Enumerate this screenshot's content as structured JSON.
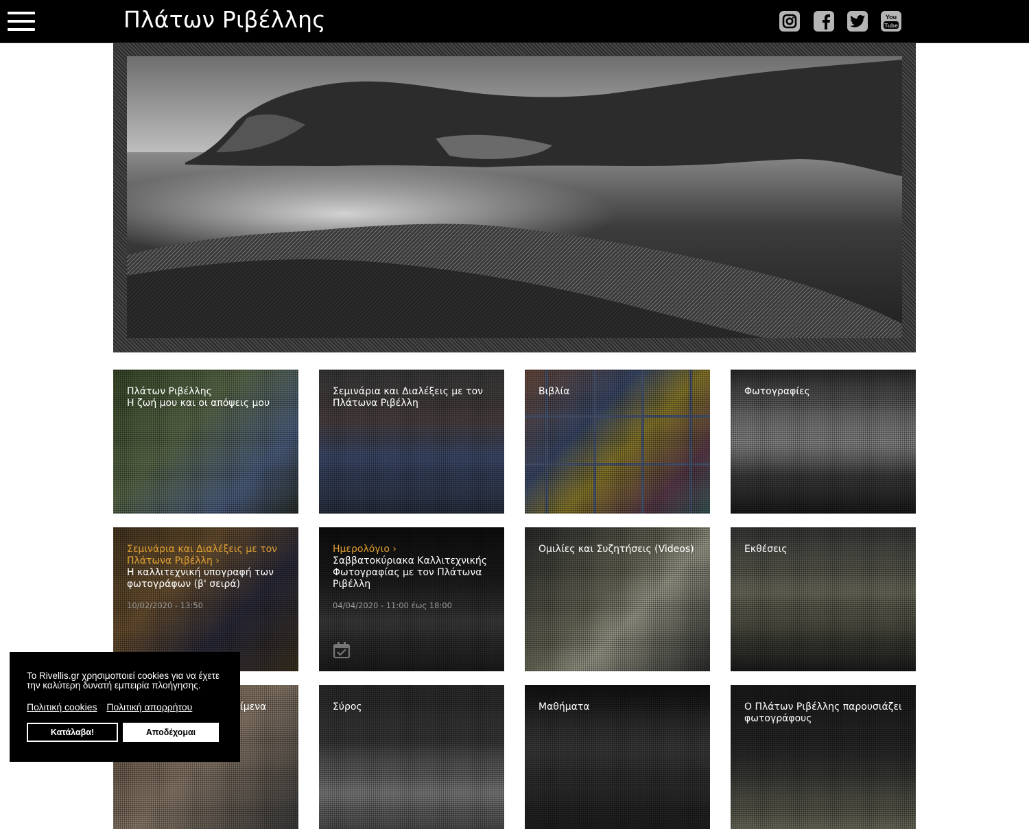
{
  "header": {
    "menu_icon": "hamburger-icon",
    "site_title": "Πλάτων Ριβέλλης",
    "social": [
      {
        "name": "instagram-icon"
      },
      {
        "name": "facebook-icon"
      },
      {
        "name": "twitter-icon"
      },
      {
        "name": "youtube-icon",
        "label": "You Tube"
      }
    ]
  },
  "hero": {
    "image": "black-and-white-coastal-bay-photo"
  },
  "tiles": [
    {
      "title": "Πλάτων Ριβέλλης",
      "subtitle": "Η ζωή μου και οι απόψεις μου"
    },
    {
      "title": "Σεμινάρια και Διαλέξεις με τον Πλάτωνα Ριβέλλη"
    },
    {
      "title": "Βιβλία"
    },
    {
      "title": "Φωτογραφίες"
    },
    {
      "category": "Σεμινάρια και Διαλέξεις με τον Πλάτωνα Ριβέλλη",
      "title": "Η καλλιτεχνική υπογραφή των φωτογράφων (β' σειρά)",
      "date": "10/02/2020 - 13:50"
    },
    {
      "category": "Ημερολόγιο",
      "title": "Σαββατοκύριακα Καλλιτεχνικής Φωτογραφίας με τον Πλάτωνα Ριβέλλη",
      "date": "04/04/2020 - 11:00 έως 18:00",
      "icon": "calendar-check-icon"
    },
    {
      "title": "Ομιλίες και Συζητήσεις (Videos)"
    },
    {
      "title": "Εκθέσεις"
    },
    {
      "title": "ίμενα"
    },
    {
      "title": "Σύρος"
    },
    {
      "title": "Μαθήματα"
    },
    {
      "title": "Ο Πλάτων Ριβέλλης παρουσιάζει φωτογράφους"
    }
  ],
  "cookie": {
    "message": "To Rivellis.gr χρησιμοποιεί cookies για να έχετε την καλύτερη δυνατή εμπειρία πλοήγησης.",
    "link_cookies": "Πολιτική cookies",
    "link_privacy": "Πολιτική απορρήτου",
    "dismiss": "Κατάλαβα!",
    "accept": "Αποδέχομαι"
  },
  "colors": {
    "header_bg": "#000000",
    "accent_orange": "#e0a032",
    "icon_grey": "#b5b5b5"
  }
}
